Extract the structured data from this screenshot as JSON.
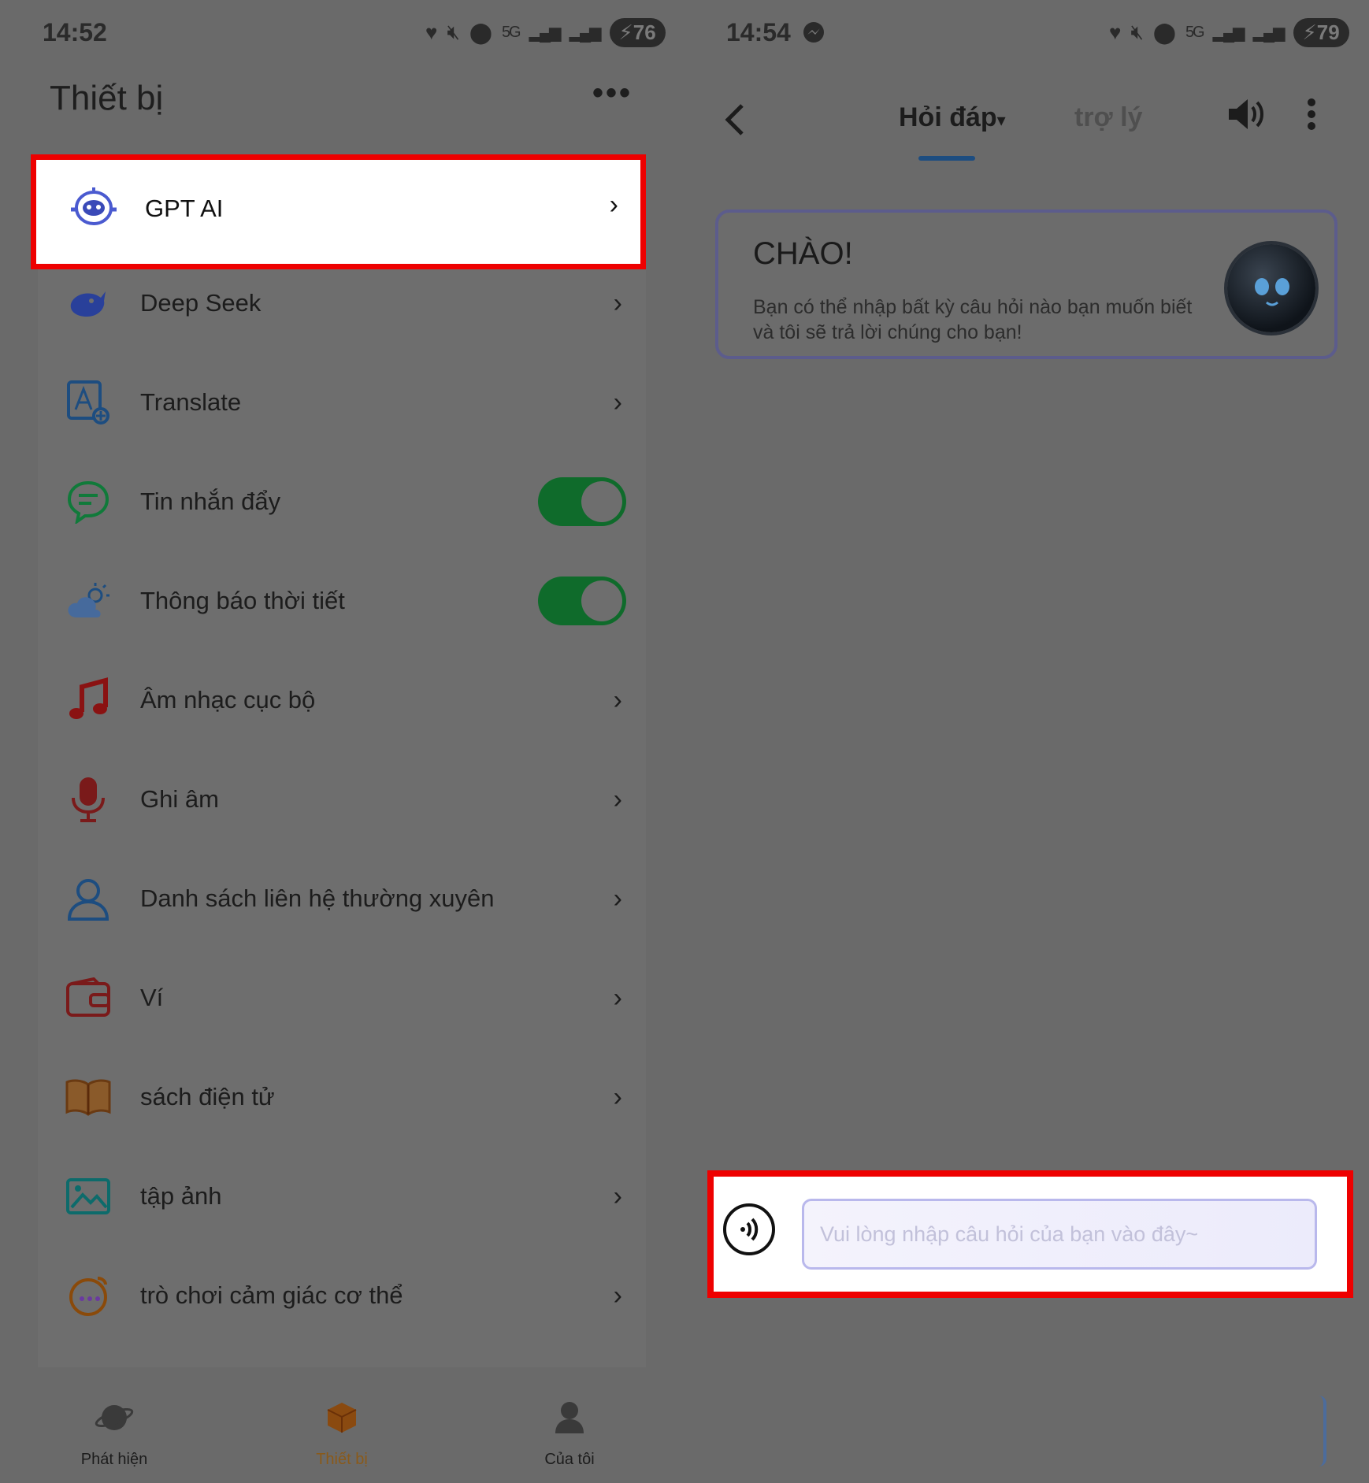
{
  "left": {
    "status": {
      "time": "14:52",
      "battery": "76",
      "network": "5G"
    },
    "title": "Thiết bị",
    "more_label": "•••",
    "items": [
      {
        "label": "GPT AI",
        "icon": "robot-icon",
        "kind": "chevron"
      },
      {
        "label": "Deep Seek",
        "icon": "whale-icon",
        "kind": "chevron"
      },
      {
        "label": "Translate",
        "icon": "translate-icon",
        "kind": "chevron"
      },
      {
        "label": "Tin nhắn đẩy",
        "icon": "chat-bubble-icon",
        "kind": "toggle",
        "on": true
      },
      {
        "label": "Thông báo thời tiết",
        "icon": "weather-icon",
        "kind": "toggle",
        "on": true
      },
      {
        "label": "Âm nhạc cục bộ",
        "icon": "music-note-icon",
        "kind": "chevron"
      },
      {
        "label": "Ghi âm",
        "icon": "microphone-icon",
        "kind": "chevron"
      },
      {
        "label": "Danh sách liên hệ thường xuyên",
        "icon": "contact-icon",
        "kind": "chevron"
      },
      {
        "label": "Ví",
        "icon": "wallet-icon",
        "kind": "chevron"
      },
      {
        "label": "sách điện tử",
        "icon": "book-icon",
        "kind": "chevron"
      },
      {
        "label": "tập ảnh",
        "icon": "photo-album-icon",
        "kind": "chevron"
      },
      {
        "label": "trò chơi cảm giác cơ thể",
        "icon": "game-icon",
        "kind": "chevron"
      }
    ],
    "chevron": "›",
    "nav": [
      {
        "label": "Phát hiện",
        "icon": "planet-icon",
        "active": false
      },
      {
        "label": "Thiết bị",
        "icon": "box-icon",
        "active": true
      },
      {
        "label": "Của tôi",
        "icon": "person-icon",
        "active": false
      }
    ]
  },
  "right": {
    "status": {
      "time": "14:54",
      "battery": "79",
      "network": "5G"
    },
    "back_label": "‹",
    "tabs": {
      "active": "Hỏi đáp",
      "inactive": "trợ lý"
    },
    "greeting": {
      "title": "CHÀO!",
      "text": "Bạn có thể nhập bất kỳ câu hỏi nào bạn muốn biết và tôi sẽ trả lời chúng cho bạn!"
    },
    "input_placeholder": "Vui lòng nhập câu hỏi của bạn vào đây~"
  },
  "colors": {
    "highlight_border": "#ee0000",
    "toggle_on": "#0f6b2b",
    "active_nav": "#8a5a1a",
    "tab_underline": "#1d4d80"
  }
}
